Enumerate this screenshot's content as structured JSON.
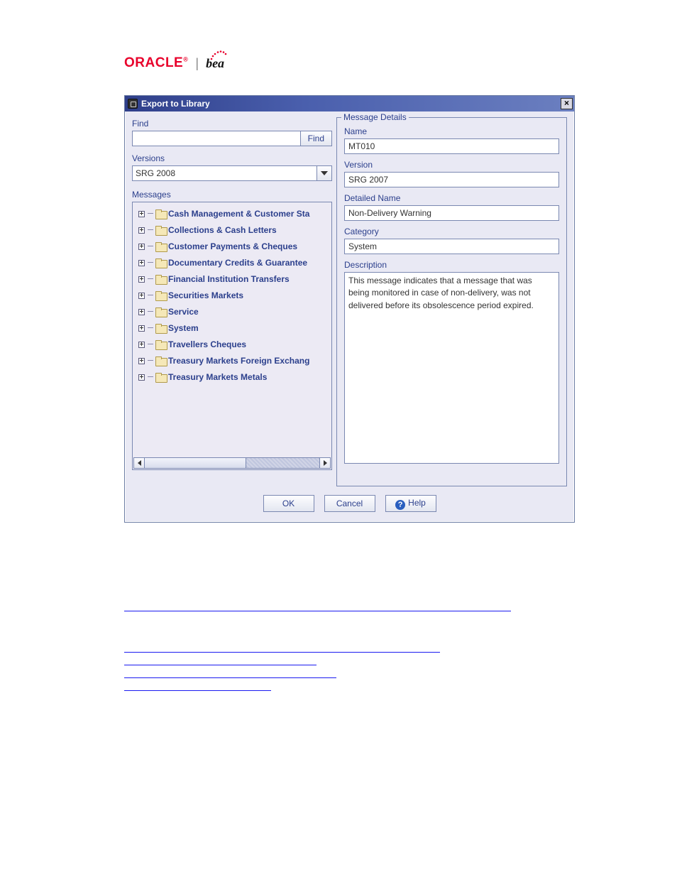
{
  "brand": {
    "oracle": "ORACLE",
    "bea": "bea"
  },
  "dialog": {
    "title": "Export to Library",
    "find_label": "Find",
    "find_button": "Find",
    "versions_label": "Versions",
    "version_selected": "SRG 2008",
    "messages_label": "Messages",
    "tree": [
      "Cash Management & Customer Sta",
      "Collections & Cash Letters",
      "Customer Payments & Cheques",
      "Documentary Credits & Guarantee",
      "Financial Institution Transfers",
      "Securities Markets",
      "Service",
      "System",
      "Travellers Cheques",
      "Treasury Markets Foreign Exchang",
      "Treasury Markets Metals"
    ]
  },
  "details": {
    "legend": "Message Details",
    "name_label": "Name",
    "name": "MT010",
    "version_label": "Version",
    "version": "SRG 2007",
    "detailed_name_label": "Detailed Name",
    "detailed_name": "Non-Delivery Warning",
    "category_label": "Category",
    "category": "System",
    "description_label": "Description",
    "description": "This message indicates that a message that was being monitored in case of non-delivery, was not delivered before its obsolescence period expired."
  },
  "buttons": {
    "ok": "OK",
    "cancel": "Cancel",
    "help": "Help"
  }
}
